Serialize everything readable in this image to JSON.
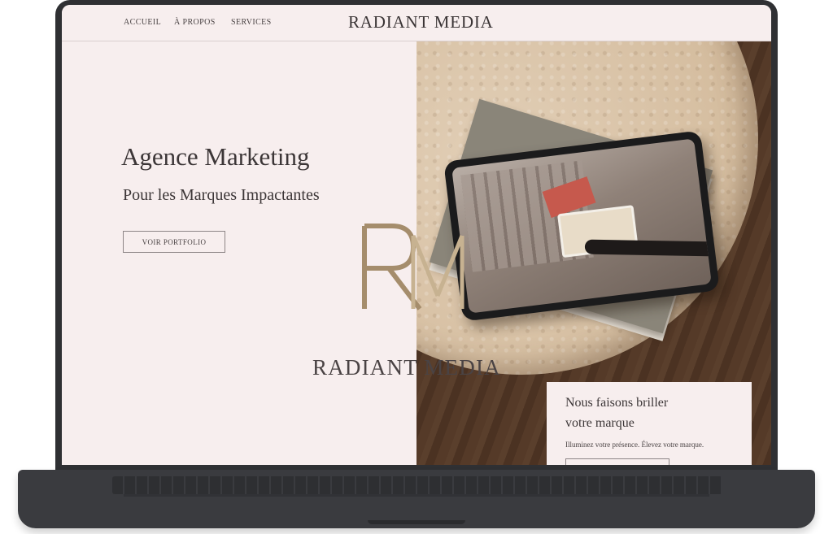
{
  "nav": {
    "links": [
      "ACCUEIL",
      "À PROPOS",
      "SERVICES"
    ],
    "brand": "RADIANT MEDIA"
  },
  "hero": {
    "title": "Agence Marketing",
    "subtitle": "Pour les Marques Impactantes",
    "cta_label": "VOIR PORTFOLIO"
  },
  "logo": {
    "monogram": "RM",
    "wordmark": "RADIANT MEDIA"
  },
  "promo": {
    "title_line1": "Nous faisons briller",
    "title_line2": "votre marque",
    "text": "Illuminez votre présence. Élevez votre marque."
  },
  "colors": {
    "background": "#f7eeee",
    "text": "#3c3637",
    "gold": "#a58d6c",
    "device": "#2f3033"
  },
  "icons": {
    "laptop": "laptop-icon"
  }
}
